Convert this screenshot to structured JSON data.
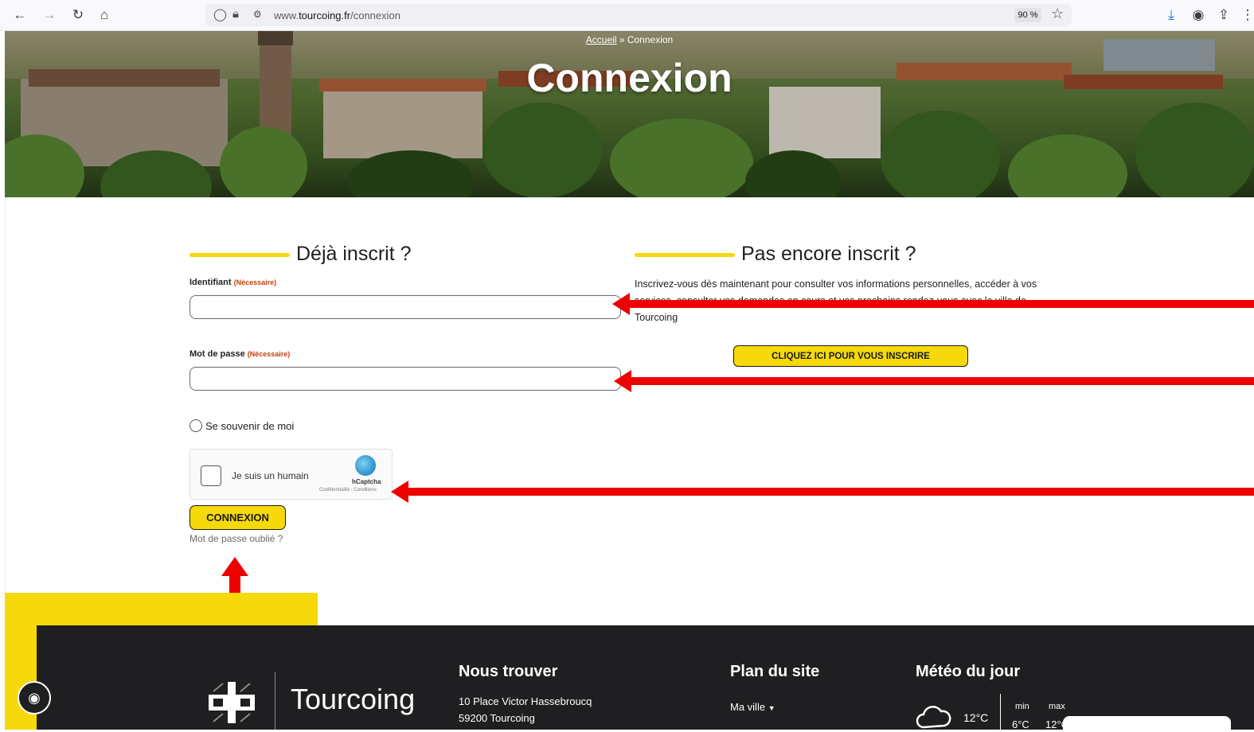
{
  "browser": {
    "url_prefix": "www.",
    "url_domain": "tourcoing.fr",
    "url_path": "/connexion",
    "zoom": "90 %"
  },
  "hero": {
    "breadcrumb_home": "Accueil",
    "breadcrumb_sep": " » ",
    "breadcrumb_current": "Connexion",
    "title": "Connexion"
  },
  "login": {
    "title": "Déjà inscrit ?",
    "identifier_label": "Identifiant",
    "identifier_required": "(Nécessaire)",
    "password_label": "Mot de passe",
    "password_required": "(Nécessaire)",
    "remember_label": "Se souvenir de moi",
    "captcha_label": "Je suis un humain",
    "captcha_brand": "hCaptcha",
    "captcha_links": "Confidentialité · Conditions",
    "submit_label": "CONNEXION",
    "forgot_label": "Mot de passe oublié ?"
  },
  "signup": {
    "title": "Pas encore inscrit ?",
    "text": "Inscrivez-vous dès maintenant pour consulter vos informations personnelles, accéder à vos services, consulter vos demandes en cours et vos prochains rendez-vous avec la ville de Tourcoing",
    "button_label": "CLIQUEZ ICI POUR VOUS INSCRIRE"
  },
  "footer": {
    "brand": "Tourcoing",
    "find_title": "Nous trouver",
    "address_line1": "10 Place Victor Hassebroucq",
    "address_line2": "59200 Tourcoing",
    "sitemap_title": "Plan du site",
    "sitemap_item": "Ma ville",
    "weather_title": "Météo du jour",
    "temp_now": "12°C",
    "min_label": "min",
    "max_label": "max",
    "min_value": "6°C",
    "max_value": "12°C"
  },
  "colors": {
    "accent_yellow": "#f5d90a",
    "footer_dark": "#1f1f22",
    "annotation_red": "#ee0000",
    "required_red": "#c2410c"
  }
}
